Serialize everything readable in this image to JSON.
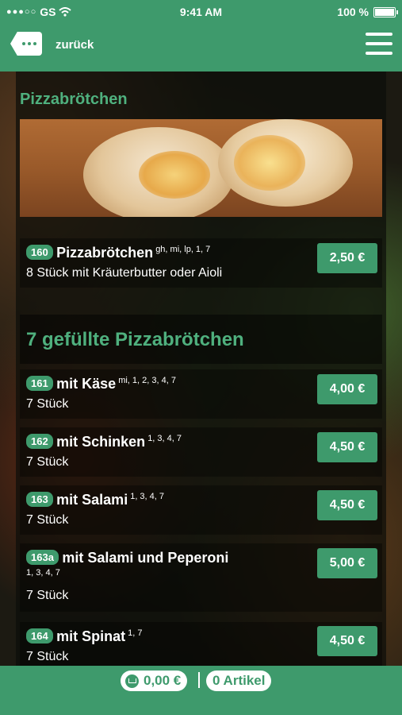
{
  "status": {
    "carrier": "GS",
    "time": "9:41 AM",
    "battery": "100 %"
  },
  "header": {
    "back_label": "zurück"
  },
  "section1": {
    "title": "Pizzabrötchen",
    "items": [
      {
        "num": "160",
        "name": "Pizzabrötchen",
        "sup": "gh, mi, lp, 1, 7",
        "desc": "8 Stück mit Kräuterbutter oder Aioli",
        "price": "2,50 €"
      }
    ]
  },
  "section2": {
    "title": "7 gefüllte Pizzabrötchen",
    "items": [
      {
        "num": "161",
        "name": "mit Käse",
        "sup": "mi, 1, 2, 3, 4, 7",
        "desc": "7 Stück",
        "price": "4,00 €"
      },
      {
        "num": "162",
        "name": "mit Schinken",
        "sup": "1, 3, 4, 7",
        "desc": "7 Stück",
        "price": "4,50 €"
      },
      {
        "num": "163",
        "name": "mit Salami",
        "sup": "1, 3, 4, 7",
        "desc": "7 Stück",
        "price": "4,50 €"
      },
      {
        "num": "163a",
        "name": "mit Salami und Peperoni",
        "sup": "1, 3, 4, 7",
        "desc": "7 Stück",
        "price": "5,00 €"
      },
      {
        "num": "164",
        "name": "mit Spinat",
        "sup": "1, 7",
        "desc": "7 Stück",
        "price": "4,50 €"
      }
    ]
  },
  "footer": {
    "cart_total": "0,00 €",
    "article_count": "0 Artikel"
  }
}
